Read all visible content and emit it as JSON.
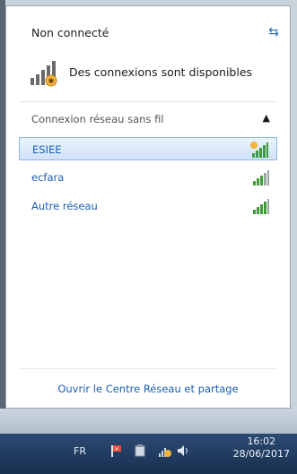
{
  "status": {
    "title": "Non connecté",
    "available_text": "Des connexions sont disponibles"
  },
  "section": {
    "label": "Connexion réseau sans fil"
  },
  "networks": [
    {
      "name": "ESIEE",
      "selected": true,
      "secured_warning": true
    },
    {
      "name": "ecfara",
      "selected": false
    },
    {
      "name": "Autre réseau",
      "selected": false
    }
  ],
  "footer": {
    "link": "Ouvrir le Centre Réseau et partage"
  },
  "taskbar": {
    "language": "FR",
    "time": "16:02",
    "date": "28/06/2017"
  },
  "colors": {
    "link": "#1a5fb4",
    "selected_bg": "#cfe2f8",
    "signal": "#3f9a3a",
    "warning": "#f2b33d"
  }
}
